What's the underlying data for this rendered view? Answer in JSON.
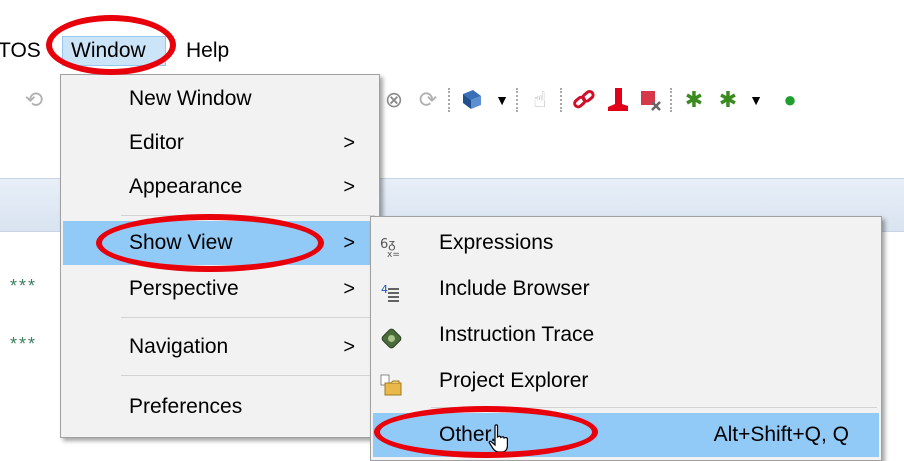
{
  "menubar": {
    "items": [
      {
        "label": "TOS"
      },
      {
        "label": "Window"
      },
      {
        "label": "Help"
      }
    ]
  },
  "editor": {
    "lines": [
      "***",
      "***"
    ]
  },
  "window_menu": {
    "items": [
      {
        "label": "New Window"
      },
      {
        "label": "Editor",
        "submenu_arrow": ">"
      },
      {
        "label": "Appearance",
        "submenu_arrow": ">"
      },
      {
        "label": "Show View",
        "submenu_arrow": ">"
      },
      {
        "label": "Perspective",
        "submenu_arrow": ">"
      },
      {
        "label": "Navigation",
        "submenu_arrow": ">"
      },
      {
        "label": "Preferences"
      }
    ]
  },
  "show_view_menu": {
    "items": [
      {
        "label": "Expressions",
        "icon": "expressions-icon"
      },
      {
        "label": "Include Browser",
        "icon": "include-browser-icon"
      },
      {
        "label": "Instruction Trace",
        "icon": "instruction-trace-icon"
      },
      {
        "label": "Project Explorer",
        "icon": "project-explorer-icon"
      },
      {
        "label": "Other...",
        "shortcut": "Alt+Shift+Q, Q"
      }
    ]
  },
  "colors": {
    "highlight": "#91c9f7",
    "menu_bg": "#f2f2f2",
    "annotation_red": "#e8000b"
  }
}
